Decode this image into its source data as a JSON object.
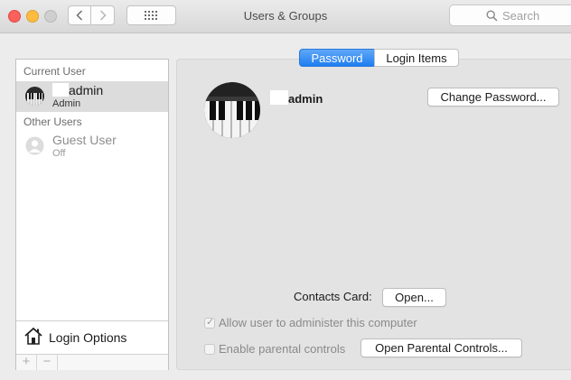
{
  "window": {
    "title": "Users & Groups"
  },
  "search": {
    "placeholder": "Search"
  },
  "sidebar": {
    "current_user_label": "Current User",
    "current_user": {
      "name": "admin",
      "role": "Admin"
    },
    "other_users_label": "Other Users",
    "guest_user": {
      "name": "Guest User",
      "status": "Off"
    },
    "login_options_label": "Login Options",
    "add_label": "+",
    "remove_label": "−"
  },
  "tabs": [
    {
      "label": "Password",
      "active": true
    },
    {
      "label": "Login Items",
      "active": false
    }
  ],
  "account": {
    "name": "admin"
  },
  "buttons": {
    "change_password": "Change Password...",
    "open": "Open...",
    "open_parental": "Open Parental Controls..."
  },
  "contacts_card_label": "Contacts Card:",
  "checkboxes": {
    "allow_admin": {
      "label": "Allow user to administer this computer",
      "checked": true
    },
    "parental": {
      "label": "Enable parental controls",
      "checked": false
    }
  },
  "colors": {
    "accent": "#1f7ef0",
    "selection": "#dcdcdc"
  },
  "icons": [
    "back-icon",
    "forward-icon",
    "grid-icon",
    "search-icon",
    "piano-avatar-icon",
    "guest-avatar-icon",
    "house-icon",
    "checkmark-icon"
  ]
}
